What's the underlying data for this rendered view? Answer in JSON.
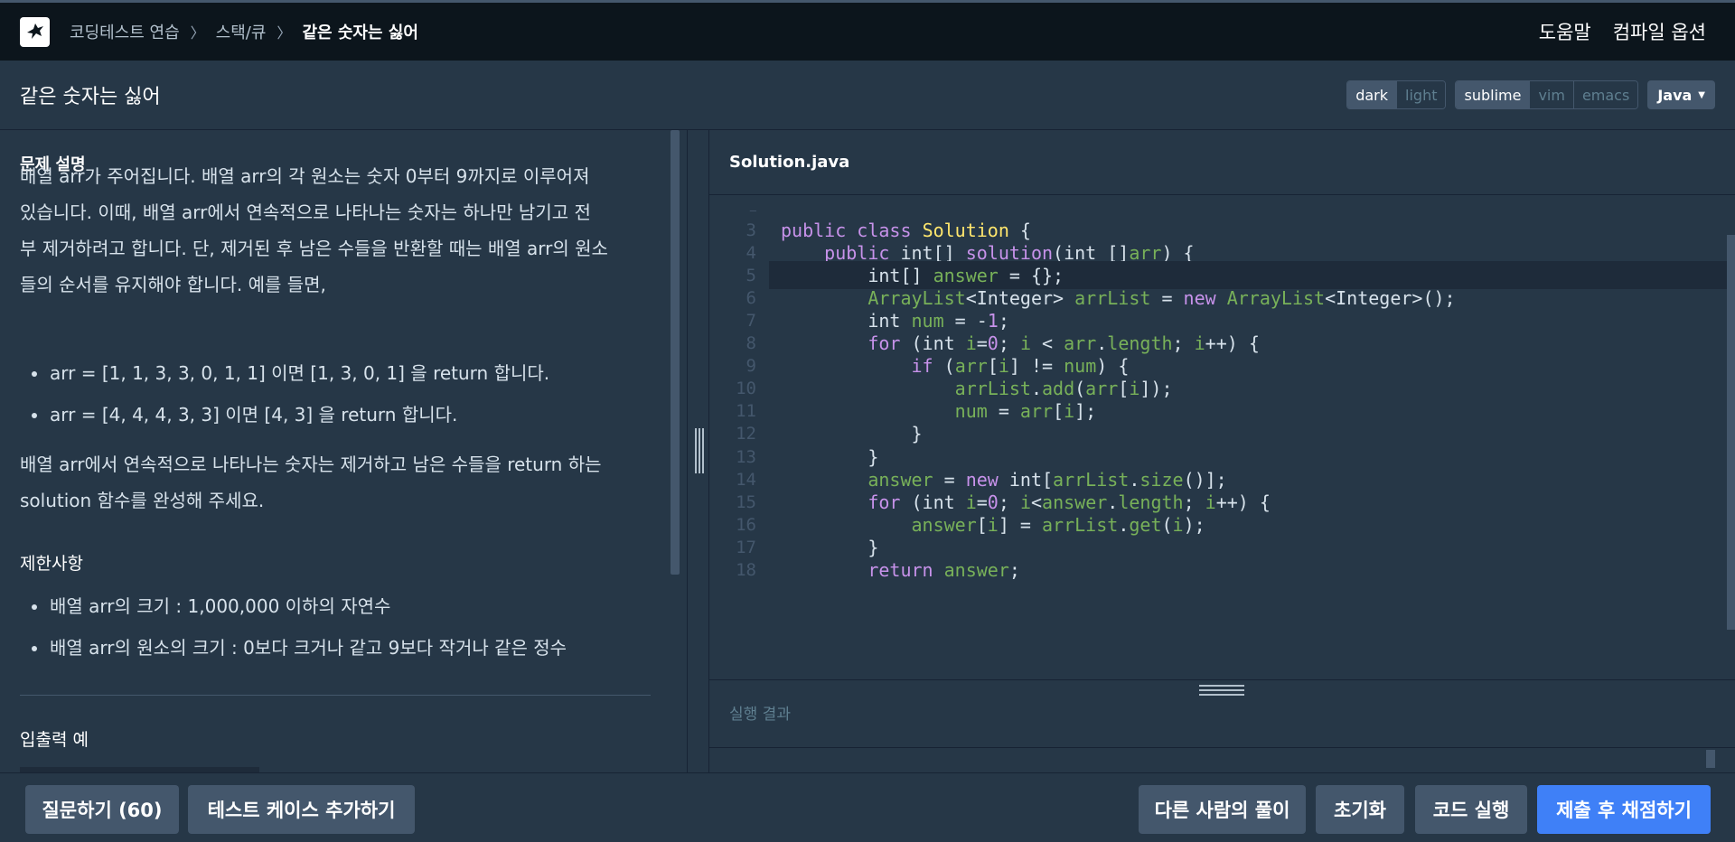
{
  "nav": {
    "breadcrumb": [
      "코딩테스트 연습",
      "스택/큐",
      "같은 숫자는 싫어"
    ],
    "help": "도움말",
    "compile_options": "컴파일 옵션"
  },
  "title": "같은 숫자는 싫어",
  "toolbar": {
    "theme": [
      "dark",
      "light"
    ],
    "keymap": [
      "sublime",
      "vim",
      "emacs"
    ],
    "language": "Java"
  },
  "problem": {
    "heading": "문제 설명",
    "para1": [
      "배열 arr가 주어집니다. 배열 arr의 각 원소는 숫자 0부터 9까지로 이루어져",
      "있습니다. 이때, 배열 arr에서 연속적으로 나타나는 숫자는 하나만 남기고 전",
      "부 제거하려고 합니다. 단, 제거된 후 남은 수들을 반환할 때는 배열 arr의 원소",
      "들의 순서를 유지해야 합니다. 예를 들면,"
    ],
    "examples": [
      "arr = [1, 1, 3, 3, 0, 1, 1] 이면 [1, 3, 0, 1] 을 return 합니다.",
      "arr = [4, 4, 4, 3, 3] 이면 [4, 3] 을 return 합니다."
    ],
    "para2": [
      "배열 arr에서 연속적으로 나타나는 숫자는 제거하고 남은 수들을 return 하는",
      "solution 함수를 완성해 주세요."
    ],
    "constraints_heading": "제한사항",
    "constraints": [
      "배열 arr의 크기 : 1,000,000 이하의 자연수",
      "배열 arr의 원소의 크기 : 0보다 크거나 같고 9보다 작거나 같은 정수"
    ],
    "io_heading": "입출력 예"
  },
  "editor": {
    "filename": "Solution.java",
    "lines": [
      {
        "n": "3",
        "code": "public class Solution {"
      },
      {
        "n": "4",
        "code": "    public int[] solution(int []arr) {"
      },
      {
        "n": "5",
        "code": "        int[] answer = {};"
      },
      {
        "n": "6",
        "code": "        ArrayList<Integer> arrList = new ArrayList<Integer>();"
      },
      {
        "n": "7",
        "code": "        int num = -1;"
      },
      {
        "n": "8",
        "code": "        for (int i=0; i < arr.length; i++) {"
      },
      {
        "n": "9",
        "code": "            if (arr[i] != num) {"
      },
      {
        "n": "10",
        "code": "                arrList.add(arr[i]);"
      },
      {
        "n": "11",
        "code": "                num = arr[i];"
      },
      {
        "n": "12",
        "code": "            }"
      },
      {
        "n": "13",
        "code": "        }"
      },
      {
        "n": "14",
        "code": "        answer = new int[arrList.size()];"
      },
      {
        "n": "15",
        "code": "        for (int i=0; i<answer.length; i++) {"
      },
      {
        "n": "16",
        "code": "            answer[i] = arrList.get(i);"
      },
      {
        "n": "17",
        "code": "        }"
      },
      {
        "n": "18",
        "code": "        return answer;"
      }
    ],
    "active_line": "5",
    "results_label": "실행 결과"
  },
  "footer": {
    "ask": "질문하기 (60)",
    "add_test": "테스트 케이스 추가하기",
    "others": "다른 사람의 풀이",
    "reset": "초기화",
    "run": "코드 실행",
    "submit": "제출 후 채점하기"
  },
  "colors": {
    "accent": "#3f80f7",
    "keyword": "#c792ea",
    "class_name": "#ffe66d",
    "identifier": "#78b159",
    "number": "#c792ea"
  }
}
